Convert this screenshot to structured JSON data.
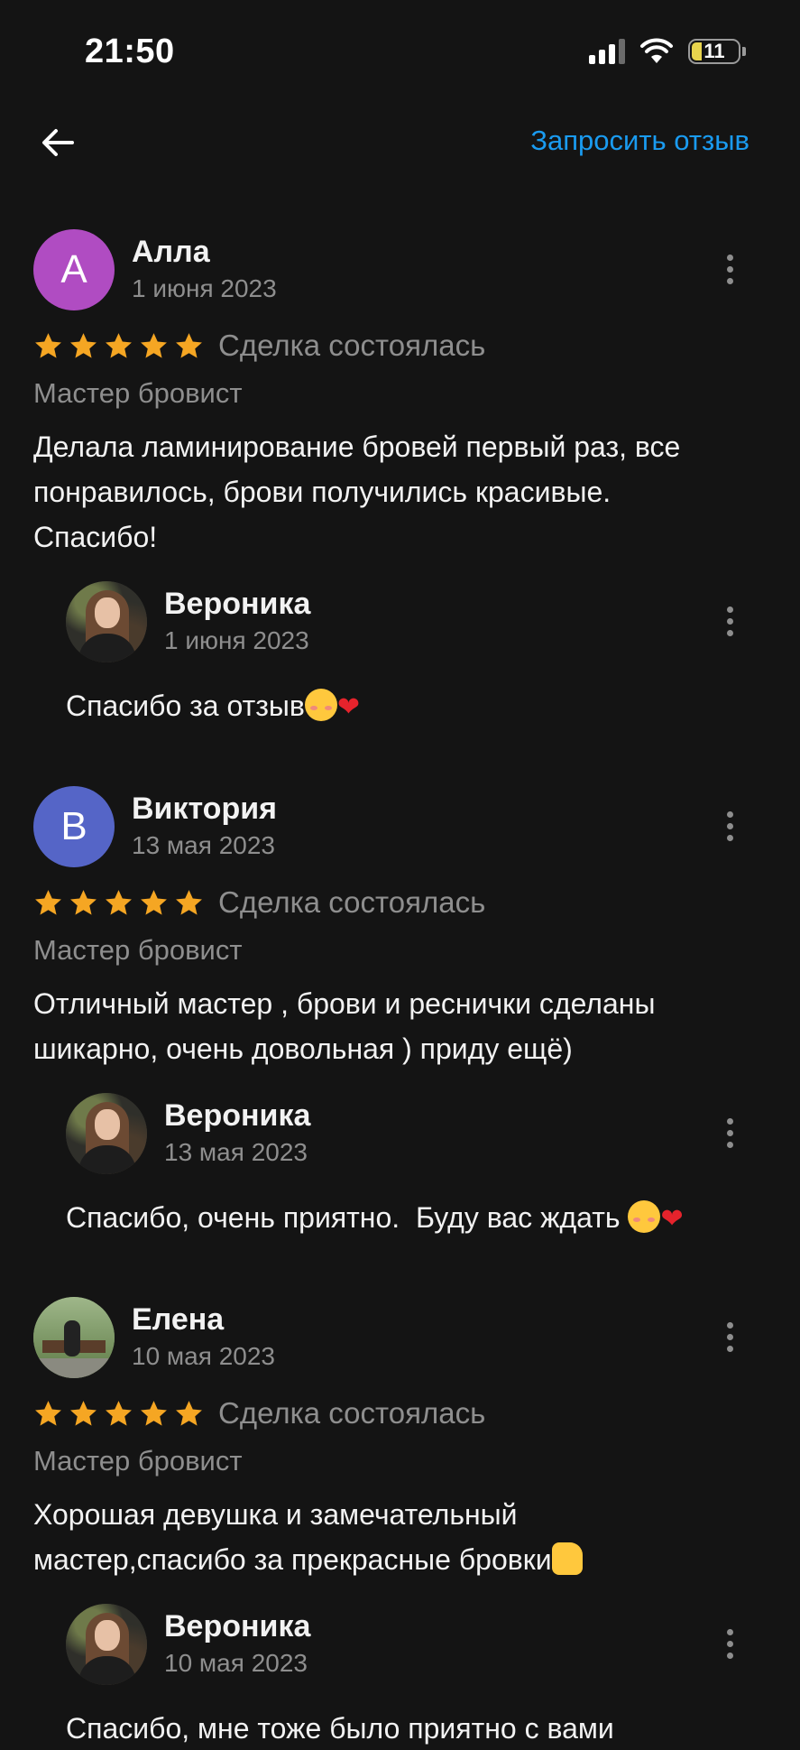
{
  "status_bar": {
    "time": "21:50",
    "battery_level": "11",
    "icons": [
      "signal-icon",
      "wifi-icon",
      "battery-icon"
    ]
  },
  "nav": {
    "back_icon": "arrow-left-icon",
    "request_review_label": "Запросить отзыв"
  },
  "colors": {
    "background": "#141414",
    "accent": "#1a9bf0",
    "star": "#f5a623",
    "avatar_a": "#b04cc2",
    "avatar_b": "#5565c7"
  },
  "reviews": [
    {
      "avatar_letter": "А",
      "author": "Алла",
      "date": "1 июня 2023",
      "rating": 5,
      "deal_status": "Сделка состоялась",
      "service": "Мастер бровист",
      "text_lines": [
        "Делала ламинирование бровей первый раз, все",
        "понравилось, брови получились красивые.",
        "Спасибо!"
      ],
      "reply": {
        "author": "Вероника",
        "date": "1 июня 2023",
        "text": "Спасибо за отзыв"
      }
    },
    {
      "avatar_letter": "В",
      "author": "Виктория",
      "date": "13 мая 2023",
      "rating": 5,
      "deal_status": "Сделка состоялась",
      "service": "Мастер бровист",
      "text_lines": [
        "Отличный мастер , брови и реснички сделаны",
        "шикарно, очень довольная ) приду ещё)"
      ],
      "reply": {
        "author": "Вероника",
        "date": "13 мая 2023",
        "text": "Спасибо, очень приятно.  Буду вас ждать "
      }
    },
    {
      "author": "Елена",
      "date": "10 мая 2023",
      "rating": 5,
      "deal_status": "Сделка состоялась",
      "service": "Мастер бровист",
      "text_lines": [
        "Хорошая девушка и замечательный",
        "мастер,спасибо за прекрасные бровки"
      ],
      "reply": {
        "author": "Вероника",
        "date": "10 мая 2023",
        "text": "Спасибо, мне тоже было приятно с вами"
      }
    }
  ]
}
